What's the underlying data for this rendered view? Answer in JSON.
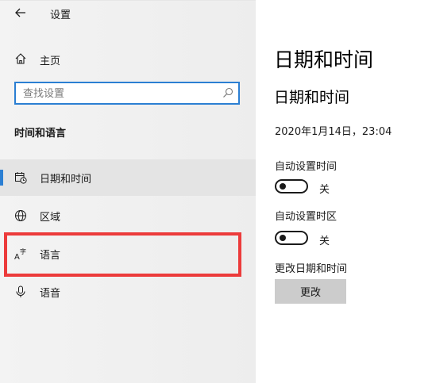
{
  "window": {
    "title": "设置"
  },
  "sidebar": {
    "home_label": "主页",
    "search": {
      "placeholder": "查找设置"
    },
    "section_heading": "时间和语言",
    "items": [
      {
        "label": "日期和时间",
        "icon": "calendar-clock-icon",
        "selected": true
      },
      {
        "label": "区域",
        "icon": "globe-icon",
        "selected": false
      },
      {
        "label": "语言",
        "icon": "language-icon",
        "selected": false
      },
      {
        "label": "语音",
        "icon": "microphone-icon",
        "selected": false
      }
    ]
  },
  "main": {
    "page_title": "日期和时间",
    "section_title": "日期和时间",
    "current_datetime": "2020年1月14日，23:04",
    "auto_time": {
      "label": "自动设置时间",
      "state": "关"
    },
    "auto_timezone": {
      "label": "自动设置时区",
      "state": "关"
    },
    "change_datetime": {
      "label": "更改日期和时间",
      "button": "更改"
    }
  },
  "colors": {
    "accent": "#2b7fd3",
    "highlight": "#ec3b3b",
    "sidebar_bg": "#f2f2f2",
    "button_bg": "#cccccc"
  }
}
